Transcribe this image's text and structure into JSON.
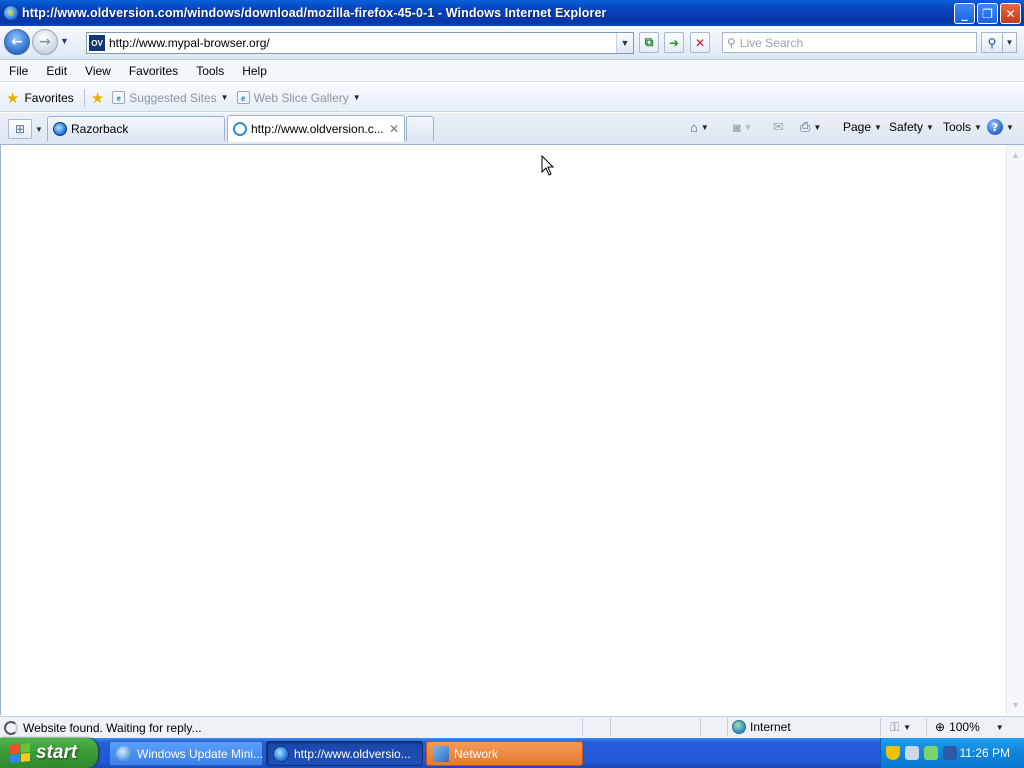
{
  "window": {
    "title": "http://www.oldversion.com/windows/download/mozilla-firefox-45-0-1 - Windows Internet Explorer",
    "controls": {
      "minimize": "_",
      "restore": "❐",
      "close": "✕"
    }
  },
  "address_bar": {
    "url": "http://www.mypal-browser.org/",
    "site_icon_text": "OV",
    "search_placeholder": "Live Search"
  },
  "menu": [
    "File",
    "Edit",
    "View",
    "Favorites",
    "Tools",
    "Help"
  ],
  "favorites_bar": {
    "favorites_label": "Favorites",
    "links": [
      "Suggested Sites",
      "Web Slice Gallery"
    ]
  },
  "tabs": [
    {
      "label": "Razorback",
      "active": false
    },
    {
      "label": "http://www.oldversion.c...",
      "active": true,
      "close": "✕"
    },
    {
      "label": "",
      "active": false
    }
  ],
  "command_bar": {
    "page": "Page",
    "safety": "Safety",
    "tools": "Tools",
    "help": "?"
  },
  "status_bar": {
    "text": "Website found. Waiting for reply...",
    "zone": "Internet",
    "zoom": "100%"
  },
  "taskbar": {
    "start_label": "start",
    "tasks": [
      {
        "label": "Windows Update Mini..."
      },
      {
        "label": "http://www.oldversio..."
      },
      {
        "label": "Network"
      }
    ],
    "clock": "11:26 PM"
  },
  "colors": {
    "title_bar": "#0840b8",
    "start_green": "#3a9a35",
    "taskbar_blue": "#245edb",
    "active_task_orange": "#e67a2e"
  }
}
